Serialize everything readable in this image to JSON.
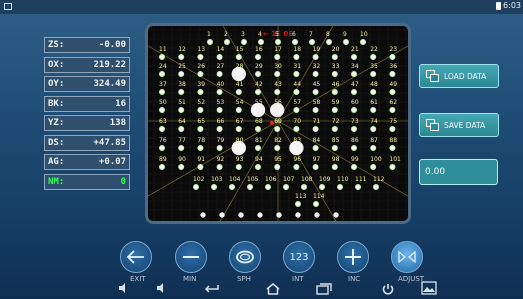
{
  "status": {
    "time": "6:03"
  },
  "display": {
    "top_label": "← 1E 0E"
  },
  "readouts": [
    {
      "label": "ZS:",
      "value": "-0.00",
      "color": "#f3f6f8"
    },
    {
      "label": "OX:",
      "value": "219.22",
      "color": "#f3f6f8"
    },
    {
      "label": "OY:",
      "value": "324.49",
      "color": "#f3f6f8"
    },
    {
      "label": "BK:",
      "value": "16",
      "color": "#f3f6f8"
    },
    {
      "label": "YZ:",
      "value": "138",
      "color": "#f3f6f8"
    },
    {
      "label": "DS:",
      "value": "+47.85",
      "color": "#f3f6f8"
    },
    {
      "label": "AG:",
      "value": "+0.07",
      "color": "#f3f6f8"
    },
    {
      "label": "NM:",
      "value": "0",
      "color": "#34ff52"
    }
  ],
  "side": {
    "load_label": "LOAD DATA",
    "save_label": "SAVE DATA",
    "value": "0.00"
  },
  "controls": {
    "zoom_label": "123"
  },
  "nav": {
    "exit": "EXIT",
    "min": "MIN",
    "sph": "SPH",
    "int": "INT",
    "inc": "INC",
    "adjust": "ADJUST"
  },
  "grid": {
    "rows": [
      [
        "1",
        "2",
        "3",
        "4",
        "5",
        "6",
        "7",
        "8",
        "9",
        "10"
      ],
      [
        "11",
        "12",
        "13",
        "14",
        "15",
        "16",
        "17",
        "18",
        "19",
        "20",
        "21",
        "22",
        "23"
      ],
      [
        "24",
        "25",
        "26",
        "27",
        "28",
        "29",
        "30",
        "31",
        "32",
        "33",
        "34",
        "35",
        "36"
      ],
      [
        "37",
        "38",
        "39",
        "40",
        "41",
        "42",
        "43",
        "44",
        "45",
        "46",
        "47",
        "48",
        "49"
      ],
      [
        "50",
        "51",
        "52",
        "53",
        "54",
        "55",
        "56",
        "57",
        "58",
        "59",
        "60",
        "61",
        "62"
      ],
      [
        "63",
        "64",
        "65",
        "66",
        "67",
        "68",
        "69",
        "70",
        "71",
        "72",
        "73",
        "74",
        "75"
      ],
      [
        "76",
        "77",
        "78",
        "79",
        "80",
        "81",
        "82",
        "83",
        "84",
        "85",
        "86",
        "87",
        "88"
      ],
      [
        "89",
        "90",
        "91",
        "92",
        "93",
        "94",
        "95",
        "96",
        "97",
        "98",
        "99",
        "100",
        "101"
      ],
      [
        "102",
        "103",
        "104",
        "105",
        "106",
        "107",
        "108",
        "109",
        "110",
        "111",
        "112"
      ],
      [
        "113",
        "114"
      ]
    ]
  }
}
